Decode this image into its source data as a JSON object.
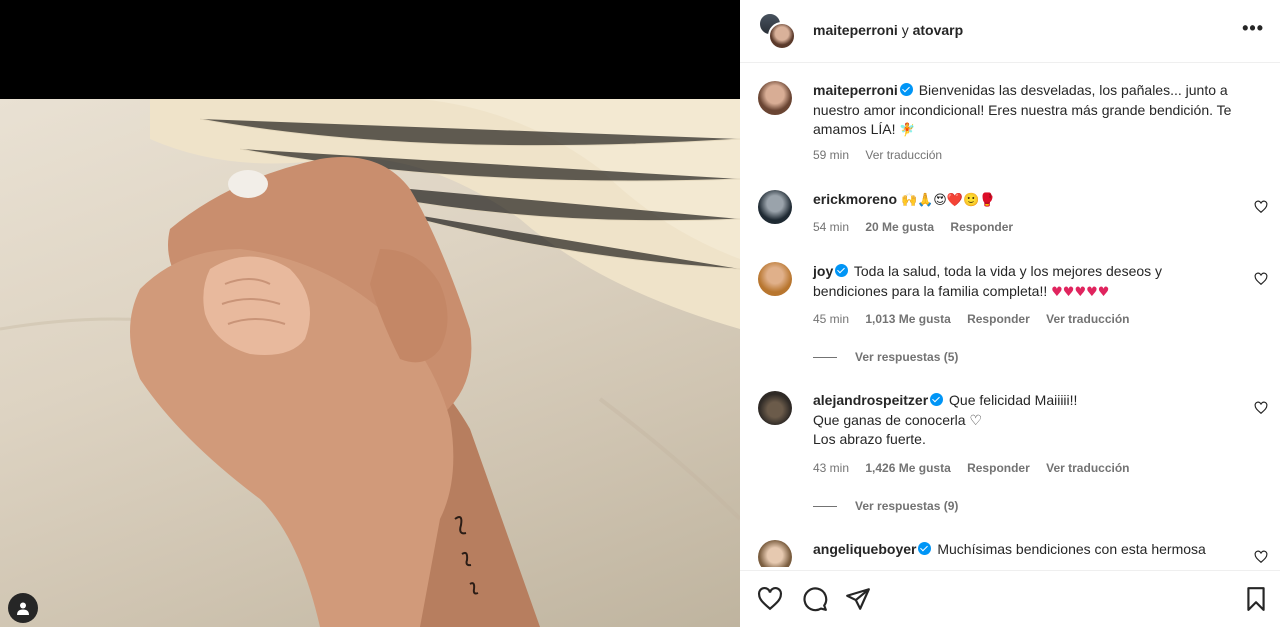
{
  "header": {
    "user1": "maiteperroni",
    "joiner": "y",
    "user2": "atovarp",
    "more_label": "•••"
  },
  "caption": {
    "username": "maiteperroni",
    "text": "Bienvenidas las desveladas, los pañales... junto a nuestro amor incondicional! Eres nuestra más grande bendición. Te amamos LÍA! ",
    "emoji": "🧚",
    "time": "59 min",
    "translate": "Ver traducción"
  },
  "comments": [
    {
      "username": "erickmoreno",
      "verified": false,
      "text": "🙌🙏😍❤️🙂🥊",
      "time": "54 min",
      "likes": "20 Me gusta",
      "reply": "Responder"
    },
    {
      "username": "joy",
      "verified": true,
      "text": "Toda la salud, toda la vida y los mejores deseos y bendiciones para la familia completa!! ",
      "hearts": "♥♥♥♥♥",
      "time": "45 min",
      "likes": "1,013 Me gusta",
      "reply": "Responder",
      "translate": "Ver traducción",
      "replies": "Ver respuestas (5)"
    },
    {
      "username": "alejandrospeitzer",
      "verified": true,
      "line1": "Que felicidad Maiiiii!!",
      "line2": "Que ganas de conocerla ♡",
      "line3": "Los abrazo fuerte.",
      "time": "43 min",
      "likes": "1,426 Me gusta",
      "reply": "Responder",
      "translate": "Ver traducción",
      "replies": "Ver respuestas (9)"
    },
    {
      "username": "angeliqueboyer",
      "verified": true,
      "text": "Muchísimas bendiciones con esta hermosa"
    }
  ],
  "icons": {
    "like": "heart-icon",
    "comment": "comment-icon",
    "share": "send-icon",
    "save": "bookmark-icon",
    "tags": "user-tag-icon"
  },
  "colors": {
    "verified": "#0095f6",
    "muted_text": "#737373",
    "heart_red": "#e0245e"
  }
}
